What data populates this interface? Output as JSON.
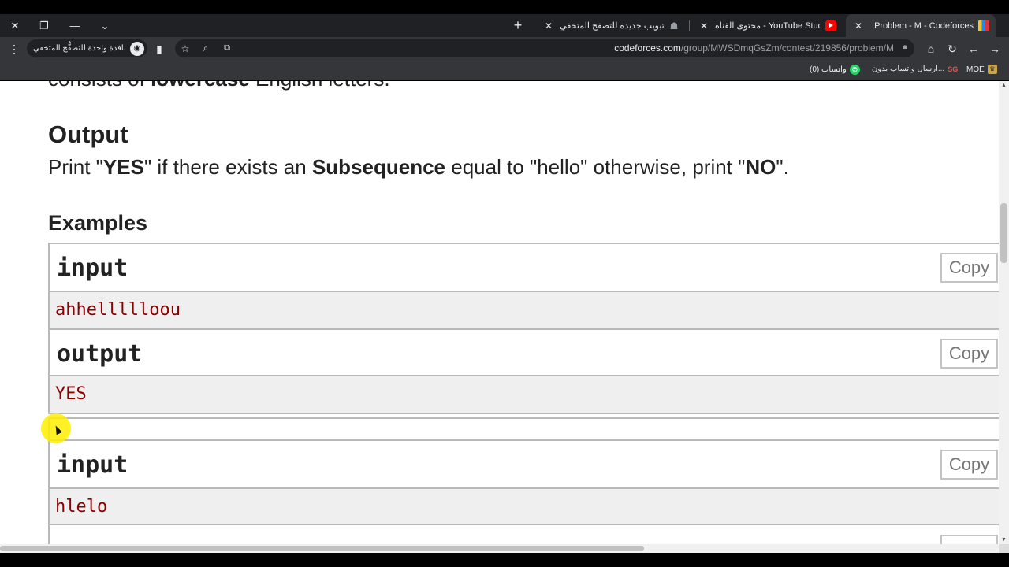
{
  "tabs": [
    {
      "title": "Problem - M - Codeforces",
      "icon": "codeforces-favicon",
      "active": true
    },
    {
      "title": "محتوى القناة - YouTube Studio",
      "icon": "youtube-favicon",
      "active": false
    },
    {
      "title": "علامة تبويب جديدة للتصفح المتخفي",
      "icon": "incognito-favicon",
      "active": false
    }
  ],
  "window_controls": {
    "close": "✕",
    "restore": "❐",
    "minimize": "—",
    "tab_search": "⌄"
  },
  "new_tab_symbol": "+",
  "toolbar": {
    "url_host": "codeforces.com",
    "url_path": "/group/MWSDmqGsZm/contest/219856/problem/M",
    "incognito_label": "نافذة واحدة للتصفُّح المتخفي",
    "menu_symbol": "⋮"
  },
  "bookmarks": [
    {
      "label": "واتساب (0)",
      "icon": "whatsapp-icon"
    },
    {
      "label": "ارسال واتساب بدون...",
      "icon": "sg-icon",
      "badge": "SG"
    },
    {
      "label": "MOE",
      "icon": "moe-icon"
    }
  ],
  "problem": {
    "partial_prefix": "consists of ",
    "partial_bold": "lowercase",
    "partial_suffix": " English letters.",
    "output_title": "Output",
    "output_part1": "Print \"",
    "output_bold1": "YES",
    "output_part2": "\" if there exists an ",
    "output_bold2": "Subsequence",
    "output_part3": " equal to \"hello\" otherwise, print \"",
    "output_bold3": "NO",
    "output_part4": "\".",
    "examples_title": "Examples",
    "copy_label": "Copy",
    "samples": [
      {
        "input_title": "input",
        "input": "ahhellllloou",
        "output_title": "output",
        "output": "YES"
      },
      {
        "input_title": "input",
        "input": "hlelo"
      }
    ]
  },
  "colors": {
    "sample_text": "#8b0000",
    "cursor_highlight": "#ffee00"
  }
}
